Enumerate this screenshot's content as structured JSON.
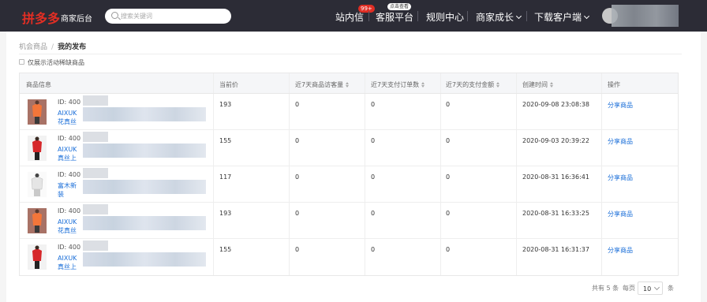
{
  "header": {
    "logo": "拼多多",
    "logo_sub": "商家后台",
    "search_placeholder": "搜索关键词",
    "nav": [
      {
        "label": "站内信",
        "badge": "99+"
      },
      {
        "label": "客服平台",
        "tag": "点击查看"
      },
      {
        "label": "规则中心"
      },
      {
        "label": "商家成长"
      },
      {
        "label": "下载客户端"
      }
    ]
  },
  "breadcrumb": {
    "parent": "机会商品",
    "separator": "/",
    "current": "我的发布"
  },
  "filter": {
    "checkbox_label": "仅展示活动稀缺商品"
  },
  "table": {
    "columns": [
      "商品信息",
      "当前价",
      "近7天商品访客量",
      "近7天支付订单数",
      "近7天的支付金额",
      "创建时间",
      "操作"
    ],
    "rows": [
      {
        "id": "ID: 400",
        "name": "AIXUK 花真丝",
        "price": "193",
        "visitors": "0",
        "orders": "0",
        "amount": "0",
        "created": "2020-09-08 23:08:38",
        "action": "分享商品",
        "thumb": "orange"
      },
      {
        "id": "ID: 400",
        "name": "AIXUK 真丝上",
        "price": "155",
        "visitors": "0",
        "orders": "0",
        "amount": "0",
        "created": "2020-09-03 20:39:22",
        "action": "分享商品",
        "thumb": "red"
      },
      {
        "id": "ID: 400",
        "name": "富木新 装",
        "price": "117",
        "visitors": "0",
        "orders": "0",
        "amount": "0",
        "created": "2020-08-31 16:36:41",
        "action": "分享商品",
        "thumb": "white"
      },
      {
        "id": "ID: 400",
        "name": "AIXUK 花真丝",
        "price": "193",
        "visitors": "0",
        "orders": "0",
        "amount": "0",
        "created": "2020-08-31 16:33:25",
        "action": "分享商品",
        "thumb": "orange"
      },
      {
        "id": "ID: 400",
        "name": "AIXUK 真丝上",
        "price": "155",
        "visitors": "0",
        "orders": "0",
        "amount": "0",
        "created": "2020-08-31 16:31:37",
        "action": "分享商品",
        "thumb": "red"
      }
    ]
  },
  "pagination": {
    "total": "共有 5 条",
    "per_page_label": "每页",
    "per_page_value": "10",
    "unit": "条"
  },
  "colors": {
    "topbar": "#2c2c36",
    "brand": "#e02e24",
    "link": "#1a6ed8"
  }
}
